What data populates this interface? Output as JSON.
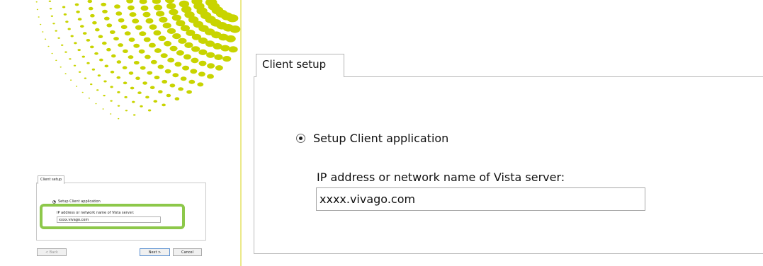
{
  "thumbnail": {
    "tab_label": "Client setup",
    "radio_label": "Setup Client application",
    "field_label": "IP address or network name of Vista server:",
    "field_value": "xxxx.vivago.com",
    "back_button": "< Back",
    "next_button": "Next >",
    "cancel_button": "Cancel",
    "highlight_color": "#8dc84a",
    "dot_color": "#c8d400"
  },
  "zoom": {
    "tab_label": "Client setup",
    "radio_label": "Setup Client application",
    "radio_selected": true,
    "field_label": "IP address or network name of Vista server:",
    "field_value": "xxxx.vivago.com"
  }
}
